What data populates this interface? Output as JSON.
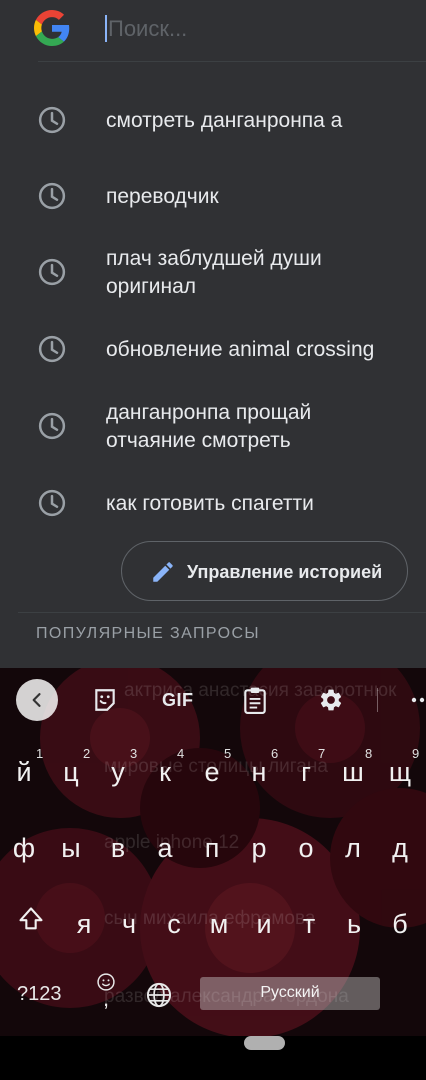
{
  "search": {
    "placeholder": "Поиск...",
    "logo_icon": "google-g-icon"
  },
  "history": [
    {
      "text": "смотреть данганронпа а",
      "icon": "clock-icon"
    },
    {
      "text": "переводчик",
      "icon": "clock-icon"
    },
    {
      "text": "плач заблудшей души\nоригинал",
      "icon": "clock-icon"
    },
    {
      "text": "обновление animal crossing",
      "icon": "clock-icon"
    },
    {
      "text": "данганронпа прощай\nотчаяние смотреть",
      "icon": "clock-icon"
    },
    {
      "text": "как готовить спагетти",
      "icon": "clock-icon"
    }
  ],
  "manage_history": {
    "label": "Управление историей",
    "icon": "pencil-icon"
  },
  "popular": {
    "title": "ПОПУЛЯРНЫЕ ЗАПРОСЫ",
    "items": [
      "актриса анастасия заворотнюк",
      "мировые столицы лигана",
      "apple iphone 12",
      "сын михаила ефремова",
      "развод александра гордона"
    ]
  },
  "keyboard": {
    "toolbar": {
      "gif_label": "GIF",
      "icons": [
        "chevron-left-icon",
        "sticker-icon",
        "gif-icon",
        "clipboard-icon",
        "gear-icon",
        "more-icon"
      ]
    },
    "row1": [
      "й",
      "ц",
      "у",
      "к",
      "е",
      "н",
      "г",
      "ш",
      "щ"
    ],
    "row1_hints": [
      "1",
      "2",
      "3",
      "4",
      "5",
      "6",
      "7",
      "8",
      "9"
    ],
    "row2": [
      "ф",
      "ы",
      "в",
      "а",
      "п",
      "р",
      "о",
      "л",
      "д"
    ],
    "row3": [
      "я",
      "ч",
      "с",
      "м",
      "и",
      "т",
      "ь",
      "б"
    ],
    "symbols_label": "?123",
    "comma_label": ",",
    "language_label": "Русский",
    "icons": [
      "shift-icon",
      "emoji-icon",
      "globe-icon"
    ]
  },
  "colors": {
    "panel_bg": "#303134",
    "text_primary": "#e8eaed",
    "text_secondary": "#9aa0a6",
    "accent_blue": "#8ab4f8"
  }
}
